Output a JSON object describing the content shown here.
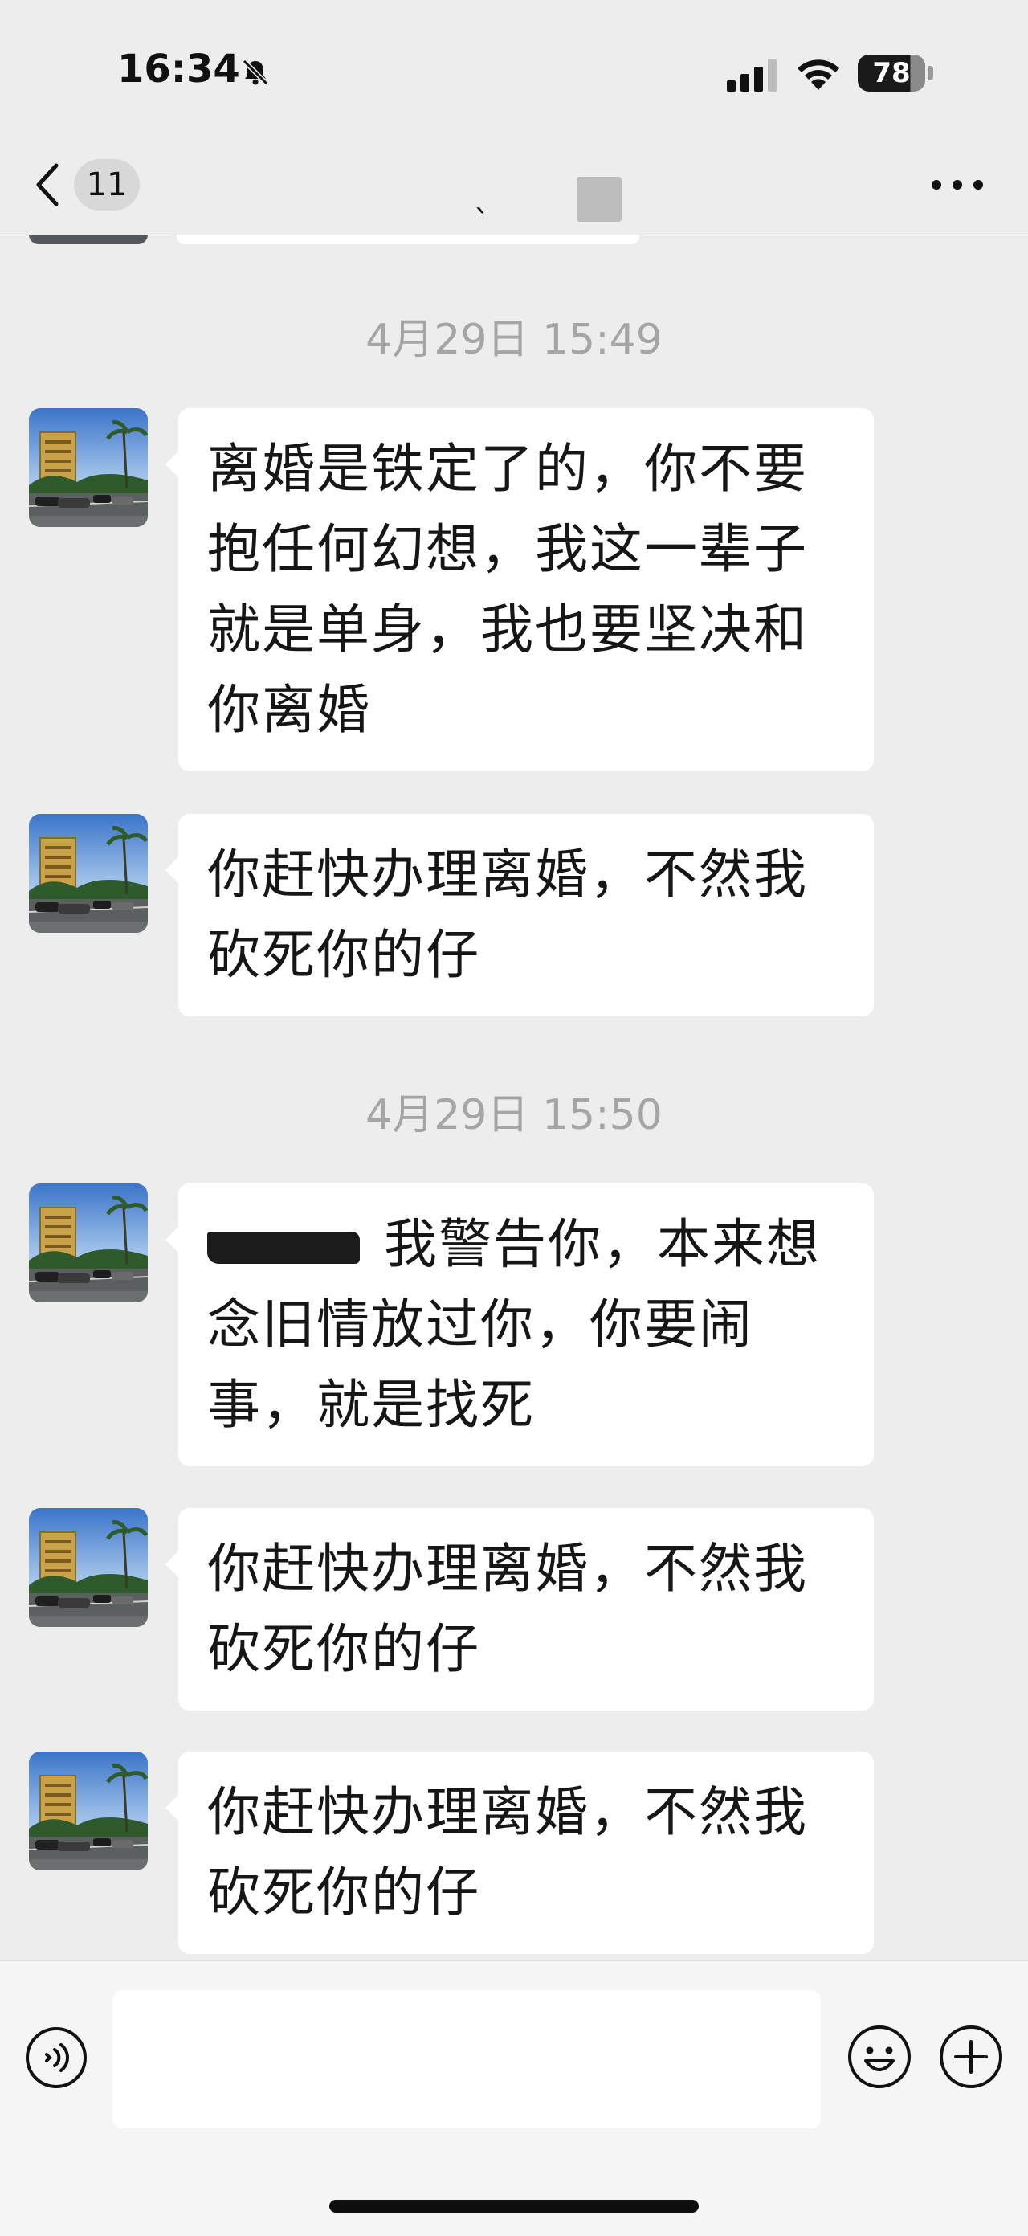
{
  "status_bar": {
    "time": "16:34",
    "battery": "78",
    "battery_level": 0.78,
    "icons": [
      "bell-muted-icon",
      "cellular-signal-icon",
      "wifi-icon",
      "battery-icon"
    ]
  },
  "nav": {
    "back_icon": "chevron-left-icon",
    "unread_count": "11",
    "title": "ˎ",
    "more_icon": "more-dots-icon"
  },
  "timestamps": [
    "4月29日 15:49",
    "4月29日 15:50"
  ],
  "messages": [
    {
      "text": "离婚是铁定了的，你不要抱任何幻想，我这一辈子就是单身，我也要坚决和你离婚"
    },
    {
      "text": "你赶快办理离婚，不然我砍死你的仔"
    },
    {
      "text": "我警告你，本来想念旧情放过你，你要闹事，就是找死",
      "redacted_prefix": true
    },
    {
      "text": "你赶快办理离婚，不然我砍死你的仔"
    },
    {
      "text": "你赶快办理离婚，不然我砍死你的仔"
    }
  ],
  "input_bar": {
    "voice_icon": "voice-input-icon",
    "emoji_icon": "emoji-icon",
    "plus_icon": "plus-circle-icon",
    "value": ""
  },
  "colors": {
    "background": "#ededed",
    "bubble": "#ffffff",
    "timestamp": "#a5a5a5",
    "text": "#161616"
  }
}
